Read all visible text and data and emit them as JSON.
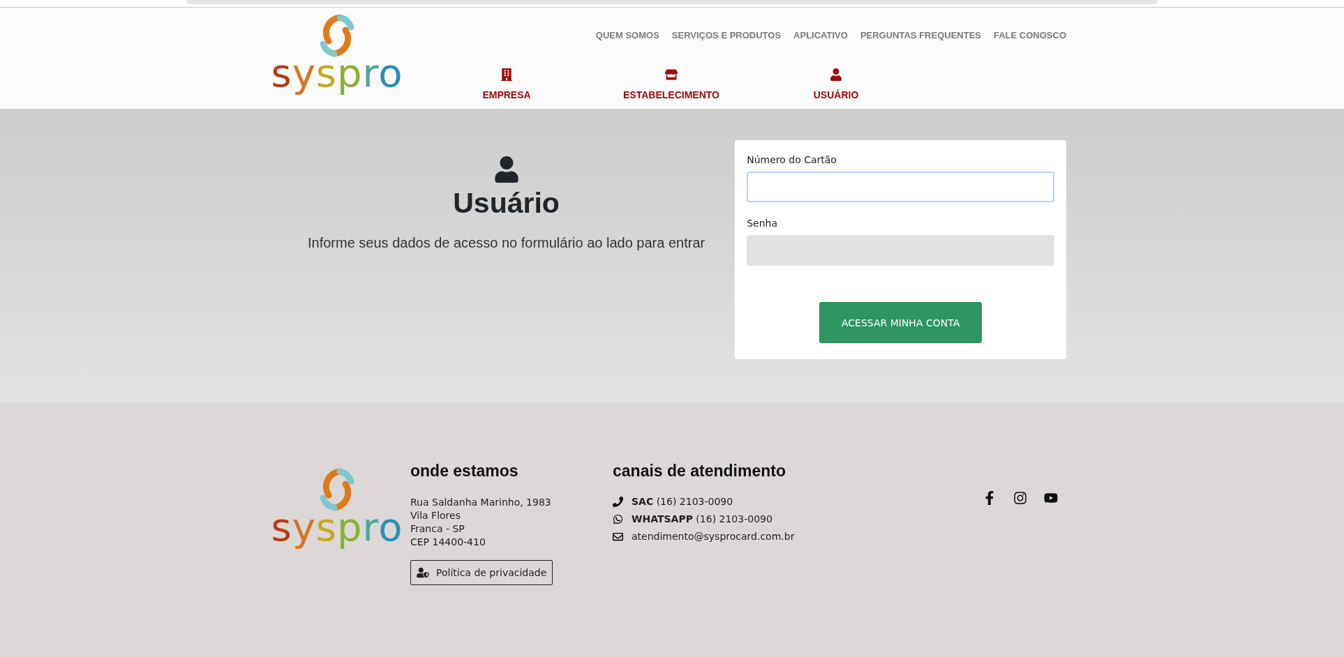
{
  "header": {
    "logo": "syspro",
    "top_nav": [
      "QUEM SOMOS",
      "SERVIÇOS E PRODUTOS",
      "APLICATIVO",
      "PERGUNTAS FREQUENTES",
      "FALE CONOSCO"
    ],
    "main_nav": [
      {
        "kind": "building",
        "label": "EMPRESA"
      },
      {
        "kind": "store",
        "label": "ESTABELECIMENTO"
      },
      {
        "kind": "user",
        "label": "USUÁRIO"
      }
    ]
  },
  "hero": {
    "title": "Usuário",
    "subtitle": "Informe seus dados de acesso no formulário ao lado para entrar"
  },
  "form": {
    "fields": [
      {
        "label": "Número do Cartão",
        "focused": true
      },
      {
        "label": "Senha",
        "focused": false
      }
    ],
    "button": "ACESSAR MINHA CONTA"
  },
  "footer": {
    "logo": "syspro",
    "location": {
      "title": "onde estamos",
      "lines": [
        "Rua Saldanha Marinho, 1983",
        "Vila Flores",
        "Franca - SP",
        "CEP 14400-410"
      ],
      "privacy_button": "Política de privacidade"
    },
    "contact": {
      "title": "canais de atendimento",
      "items": [
        {
          "kind": "phone",
          "text": "**SAC** (16) 2103-0090"
        },
        {
          "kind": "whatsapp",
          "text": "**WHATSAPP** (16) 2103-0090"
        },
        {
          "kind": "email",
          "text": "atendimento@sysprocard.com.br"
        }
      ]
    },
    "social": [
      {
        "kind": "facebook"
      },
      {
        "kind": "instagram"
      },
      {
        "kind": "youtube"
      }
    ]
  }
}
